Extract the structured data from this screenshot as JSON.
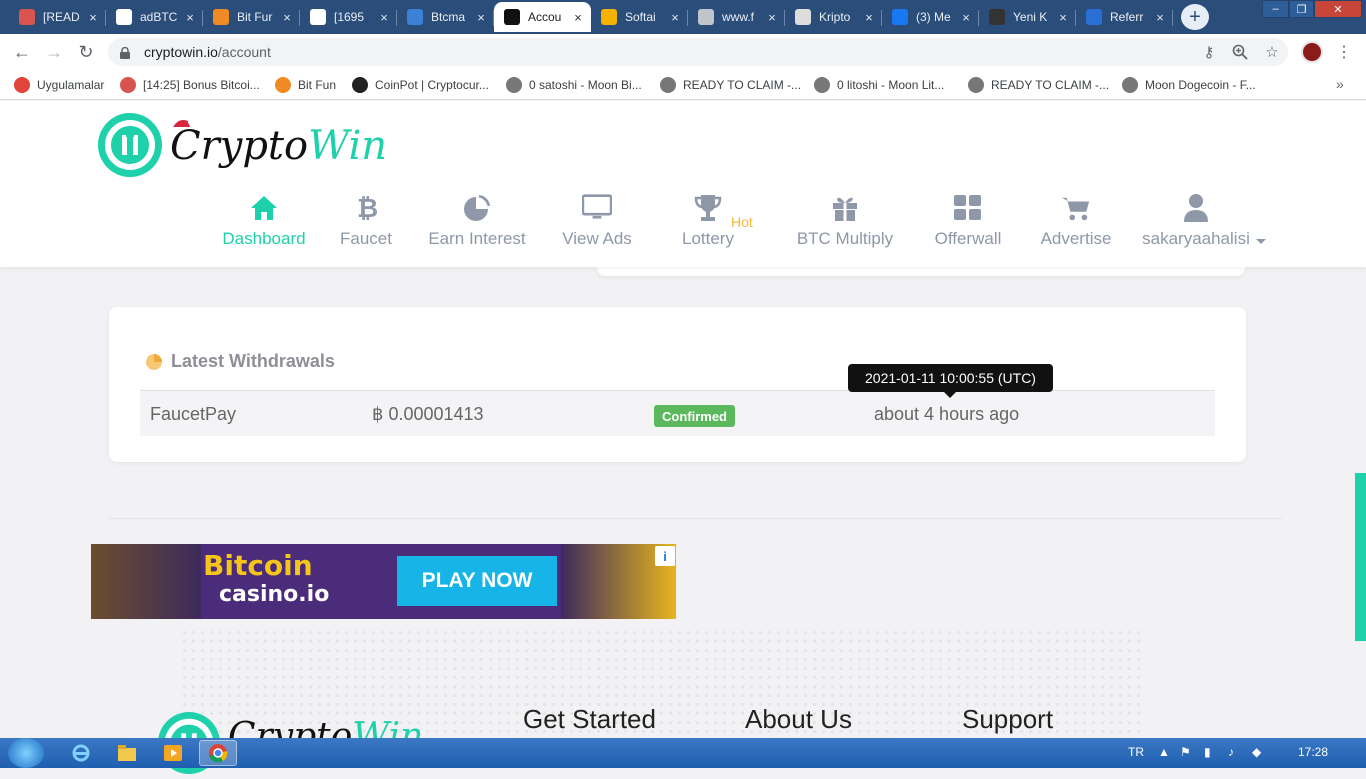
{
  "browser": {
    "tabs": [
      {
        "label": "[READ",
        "icon": "x-logo-icon",
        "color": "#d9534f"
      },
      {
        "label": "adBTC",
        "icon": "btc-square-icon",
        "color": "#ffffff"
      },
      {
        "label": "Bit Fur",
        "icon": "orange-cross-icon",
        "color": "#f08a24"
      },
      {
        "label": "[1695",
        "icon": "f-square-icon",
        "color": "#ffffff"
      },
      {
        "label": "Btcma",
        "icon": "gear-circle-icon",
        "color": "#3b82d6"
      },
      {
        "label": "Accou",
        "icon": "b-logo-icon",
        "color": "#111111",
        "active": true
      },
      {
        "label": "Softai",
        "icon": "b-yellow-icon",
        "color": "#f5b300"
      },
      {
        "label": "www.f",
        "icon": "globe-icon",
        "color": "#c0c4cc"
      },
      {
        "label": "Kripto",
        "icon": "d-circle-icon",
        "color": "#dddddd"
      },
      {
        "label": "(3) Me",
        "icon": "facebook-icon",
        "color": "#1877f2"
      },
      {
        "label": "Yeni K",
        "icon": "feather-icon",
        "color": "#333333"
      },
      {
        "label": "Referr",
        "icon": "fp-icon",
        "color": "#2a6fd6"
      }
    ],
    "new_tab": "+",
    "close_glyph": "×",
    "url_host": "cryptowin.io",
    "url_path": "/account",
    "bookmarks": [
      {
        "label": "Uygulamalar",
        "icon": "apps-grid-icon"
      },
      {
        "label": "[14:25] Bonus Bitcoi...",
        "icon": "x-logo-icon"
      },
      {
        "label": "Bit Fun",
        "icon": "orange-cross-icon"
      },
      {
        "label": "CoinPot | Cryptocur...",
        "icon": "coinpot-icon"
      },
      {
        "label": "0 satoshi - Moon Bi...",
        "icon": "moon-icon"
      },
      {
        "label": "READY TO CLAIM -...",
        "icon": "moon-icon"
      },
      {
        "label": "0 litoshi - Moon Lit...",
        "icon": "moon-icon"
      },
      {
        "label": "READY TO CLAIM -...",
        "icon": "moon-icon"
      },
      {
        "label": "Moon Dogecoin - F...",
        "icon": "moon-icon"
      }
    ],
    "bookmarks_more": "»"
  },
  "site": {
    "logo_part1": "Crypto",
    "logo_part2": "Win",
    "brand_color": "#1fd1ab",
    "nav": [
      {
        "label": "Dashboard",
        "icon": "home-icon",
        "active": true
      },
      {
        "label": "Faucet",
        "icon": "bitcoin-icon"
      },
      {
        "label": "Earn Interest",
        "icon": "pie-chart-icon"
      },
      {
        "label": "View Ads",
        "icon": "monitor-icon"
      },
      {
        "label": "Lottery",
        "icon": "trophy-icon"
      },
      {
        "label": "BTC Multiply",
        "icon": "gift-icon"
      },
      {
        "label": "Offerwall",
        "icon": "grid-icon"
      },
      {
        "label": "Advertise",
        "icon": "cart-icon"
      },
      {
        "label": "sakaryaahalisi",
        "icon": "user-icon"
      }
    ],
    "hot_badge": "Hot"
  },
  "withdrawals": {
    "title": "Latest Withdrawals",
    "rows": [
      {
        "method": "FaucetPay",
        "amount": "0.00001413",
        "currency_symbol": "฿",
        "status": "Confirmed",
        "status_color": "#5cb85c",
        "time": "about 4 hours ago"
      }
    ],
    "tooltip": "2021-01-11 10:00:55 (UTC)"
  },
  "ad": {
    "logo_line1": "Bitcoin",
    "logo_line2": "casino.io",
    "cta": "PLAY NOW",
    "info": "i"
  },
  "footer": {
    "logo_part1": "Crypto",
    "logo_part2": "Win",
    "headings": [
      "Get Started",
      "About Us",
      "Support"
    ]
  },
  "taskbar": {
    "lang": "TR",
    "clock": "17:28"
  }
}
